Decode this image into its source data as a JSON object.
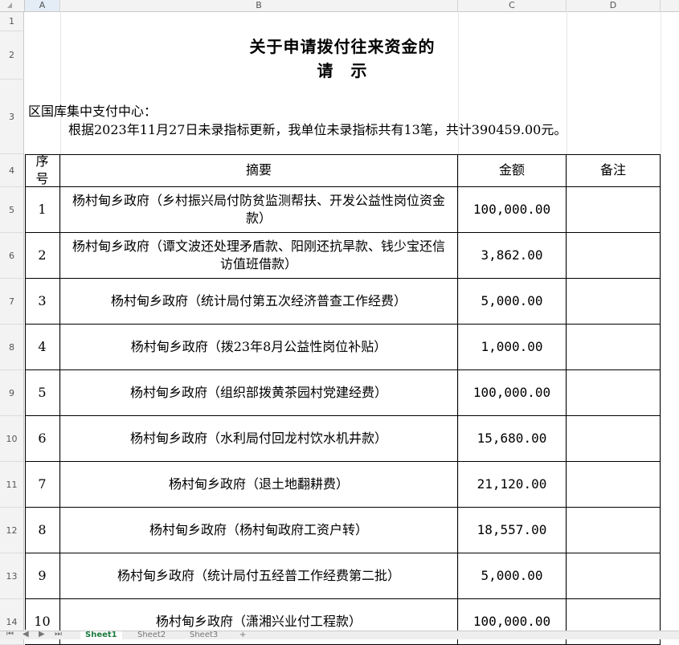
{
  "columns": [
    "A",
    "B",
    "C",
    "D"
  ],
  "rows": [
    "1",
    "2",
    "3",
    "4",
    "5",
    "6",
    "7",
    "8",
    "9",
    "10",
    "11",
    "12",
    "13",
    "14"
  ],
  "title_line1": "关于申请拨付往来资金的",
  "title_line2": "请　示",
  "addressee": "区国库集中支付中心：",
  "body_text": "根据2023年11月27日未录指标更新，我单位未录指标共有13笔，共计390459.00元。",
  "table": {
    "headers": {
      "seq": "序号",
      "summary": "摘要",
      "amount": "金额",
      "remark": "备注"
    },
    "rows": [
      {
        "seq": "1",
        "summary": "杨村甸乡政府（乡村振兴局付防贫监测帮扶、开发公益性岗位资金款）",
        "amount": "100,000.00",
        "remark": ""
      },
      {
        "seq": "2",
        "summary": "杨村甸乡政府（谭文波还处理矛盾款、阳刚还抗旱款、钱少宝还信访值班借款）",
        "amount": "3,862.00",
        "remark": ""
      },
      {
        "seq": "3",
        "summary": "杨村甸乡政府（统计局付第五次经济普查工作经费）",
        "amount": "5,000.00",
        "remark": ""
      },
      {
        "seq": "4",
        "summary": "杨村甸乡政府（拨23年8月公益性岗位补贴）",
        "amount": "1,000.00",
        "remark": ""
      },
      {
        "seq": "5",
        "summary": "杨村甸乡政府（组织部拨黄茶园村党建经费）",
        "amount": "100,000.00",
        "remark": ""
      },
      {
        "seq": "6",
        "summary": "杨村甸乡政府（水利局付回龙村饮水机井款）",
        "amount": "15,680.00",
        "remark": ""
      },
      {
        "seq": "7",
        "summary": "杨村甸乡政府（退土地翻耕费）",
        "amount": "21,120.00",
        "remark": ""
      },
      {
        "seq": "8",
        "summary": "杨村甸乡政府（杨村甸政府工资户转）",
        "amount": "18,557.00",
        "remark": ""
      },
      {
        "seq": "9",
        "summary": "杨村甸乡政府（统计局付五经普工作经费第二批）",
        "amount": "5,000.00",
        "remark": ""
      },
      {
        "seq": "10",
        "summary": "杨村甸乡政府（潇湘兴业付工程款）",
        "amount": "100,000.00",
        "remark": ""
      }
    ]
  },
  "sheet_tabs": [
    "Sheet1",
    "Sheet2",
    "Sheet3"
  ],
  "active_tab": "Sheet1",
  "nav_icons": [
    "first-sheet-icon",
    "prev-sheet-icon",
    "next-sheet-icon",
    "last-sheet-icon"
  ]
}
